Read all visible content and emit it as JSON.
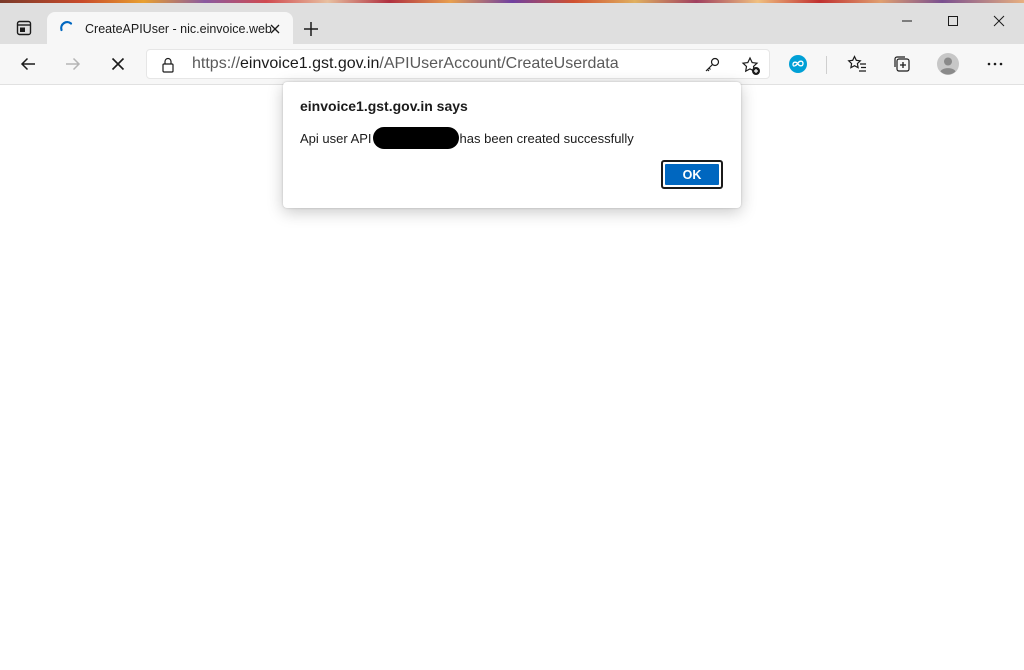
{
  "browser": {
    "tab": {
      "title": "CreateAPIUser - nic.einvoice.web"
    },
    "address": {
      "url_prefix": "https://",
      "host": "einvoice1.gst.gov.in",
      "path": "/APIUserAccount/CreateUserdata"
    },
    "colors": {
      "accent": "#0067c0",
      "tabbar_bg": "#dfdfdf",
      "toolbar_bg": "#f7f7f7",
      "copilot": "#00a0d6"
    },
    "icons": [
      "tab-actions-icon",
      "loading-spinner-icon",
      "close-icon",
      "plus-icon",
      "minimize-icon",
      "maximize-icon",
      "back-arrow-icon",
      "forward-arrow-icon",
      "stop-icon",
      "lock-icon",
      "key-icon",
      "add-favorite-icon",
      "extension-icon",
      "favorites-icon",
      "collections-icon",
      "profile-icon",
      "more-icon"
    ]
  },
  "dialog": {
    "title": "einvoice1.gst.gov.in says",
    "message_before": "Api user API",
    "message_after": "has been created successfully",
    "ok_label": "OK"
  }
}
